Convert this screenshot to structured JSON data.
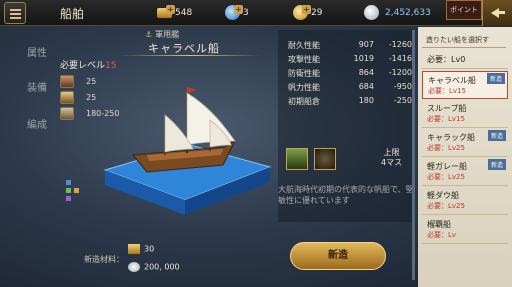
{
  "header": {
    "title": "船舶",
    "resources": [
      {
        "name": "bar-icon",
        "value": "548"
      },
      {
        "name": "potion-icon",
        "value": "3"
      },
      {
        "name": "coin-icon",
        "value": "29"
      },
      {
        "name": "silver-icon",
        "value": "2,452,633"
      }
    ],
    "point_tab": "ポイント"
  },
  "sidebar": [
    "属性",
    "装備",
    "編成"
  ],
  "ship": {
    "category": "軍用艦",
    "name": "キャラベル船"
  },
  "requirements": {
    "heading": "必要レベル",
    "level": "15",
    "rows": [
      {
        "value": "25"
      },
      {
        "value": "25"
      },
      {
        "value": "180-250"
      }
    ]
  },
  "stats": [
    {
      "label": "耐久性能",
      "min": "907",
      "max": "1260"
    },
    {
      "label": "攻撃性能",
      "min": "1019",
      "max": "1416"
    },
    {
      "label": "防衛性能",
      "min": "864",
      "max": "1200"
    },
    {
      "label": "帆力性能",
      "min": "684",
      "max": "950"
    },
    {
      "label": "初期船倉",
      "min": "180",
      "max": "250"
    }
  ],
  "upper_limit": {
    "line1": "上限",
    "line2": "4マス"
  },
  "description": "大航海時代初期の代表的な帆船で、堅敏性に優れています",
  "cost": {
    "label": "新造材料：",
    "items": [
      {
        "value": "30"
      },
      {
        "value": "200, 000"
      }
    ]
  },
  "build_button": "新造",
  "ship_list": {
    "heading": "造りたい船を選択す",
    "items": [
      {
        "name": "必要：Lv0",
        "level": "",
        "badge": ""
      },
      {
        "name": "キャラベル船",
        "level": "必要：Lv15",
        "badge": "新造"
      },
      {
        "name": "スループ船",
        "level": "必要：Lv15",
        "badge": ""
      },
      {
        "name": "キャラック船",
        "level": "必要：Lv25",
        "badge": "新造"
      },
      {
        "name": "軽ガレー船",
        "level": "必要：Lv25",
        "badge": "新造"
      },
      {
        "name": "軽ダウ船",
        "level": "必要：Lv25",
        "badge": ""
      },
      {
        "name": "榴覇船",
        "level": "必要：Lv",
        "badge": ""
      }
    ]
  },
  "colors": {
    "accent_gold": "#c9a04a",
    "req_red": "#e25b4a",
    "silver_blue": "#8fc7ff"
  }
}
